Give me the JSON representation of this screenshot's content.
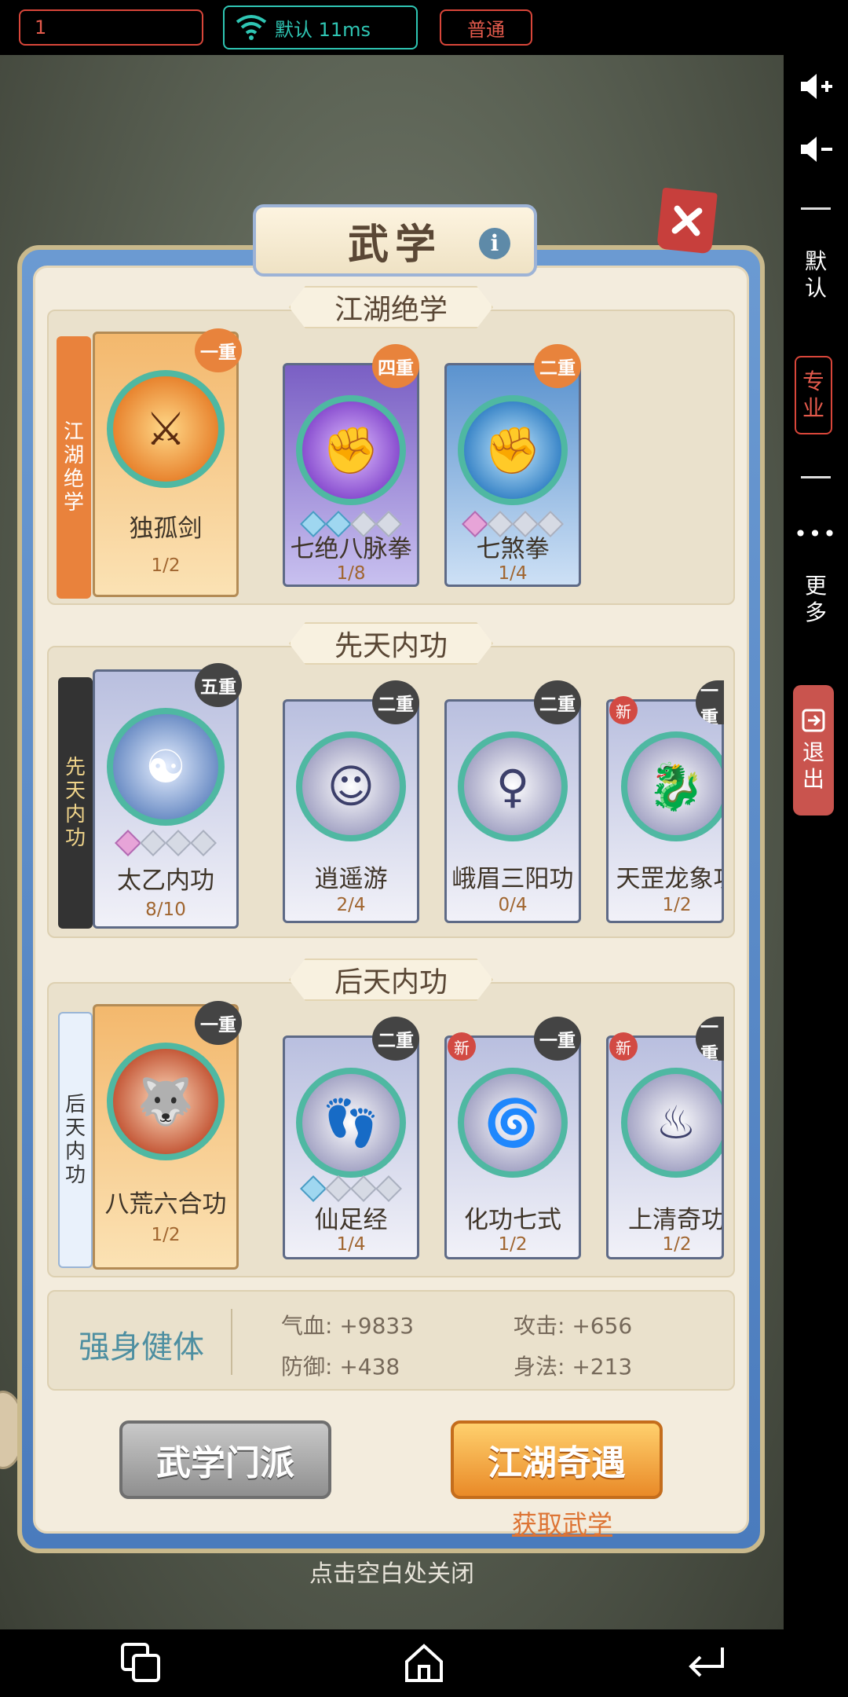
{
  "top_bar": {
    "field_value": "1",
    "network_label": "默认 11ms",
    "mode_label": "普通"
  },
  "right_bar": {
    "default_label": "默认",
    "pro_label": "专业",
    "more_label": "更多",
    "exit_label": "退出"
  },
  "dialog": {
    "title": "武学",
    "info_icon": "i",
    "sections": [
      {
        "title": "江湖绝学",
        "scroll_label": "江湖绝学",
        "cards": [
          {
            "name": "独孤剑",
            "count": "1/2",
            "tier": "一重",
            "style": "gold",
            "icon": "sword"
          },
          {
            "name": "七绝八脉拳",
            "count": "1/8",
            "tier": "四重",
            "style": "purple",
            "icon": "fist"
          },
          {
            "name": "七煞拳",
            "count": "1/4",
            "tier": "二重",
            "style": "blue",
            "icon": "fist"
          }
        ]
      },
      {
        "title": "先天内功",
        "scroll_label": "先天内功",
        "cards": [
          {
            "name": "太乙内功",
            "count": "8/10",
            "tier": "五重",
            "style": "silver",
            "icon": "yin-yang"
          },
          {
            "name": "逍遥游",
            "count": "2/4",
            "tier": "二重",
            "style": "silver",
            "icon": "monk"
          },
          {
            "name": "峨眉三阳功",
            "count": "0/4",
            "tier": "二重",
            "style": "silver",
            "icon": "lady"
          },
          {
            "name": "天罡龙象功",
            "count": "1/2",
            "tier": "一重",
            "new": "新",
            "style": "silver",
            "icon": "dragon"
          }
        ]
      },
      {
        "title": "后天内功",
        "scroll_label": "后天内功",
        "cards": [
          {
            "name": "八荒六合功",
            "count": "1/2",
            "tier": "一重",
            "style": "gold",
            "icon": "wolf"
          },
          {
            "name": "仙足经",
            "count": "1/4",
            "tier": "二重",
            "style": "silver",
            "icon": "foot"
          },
          {
            "name": "化功七式",
            "count": "1/2",
            "tier": "一重",
            "new": "新",
            "style": "silver",
            "icon": "swirl"
          },
          {
            "name": "上清奇功",
            "count": "1/2",
            "tier": "一重",
            "new": "新",
            "style": "silver",
            "icon": "bowl"
          }
        ]
      }
    ],
    "stats": {
      "title": "强身健体",
      "hp": "气血: +9833",
      "attack": "攻击: +656",
      "defense": "防御: +438",
      "agility": "身法: +213"
    },
    "school_button": "武学门派",
    "adventure_button": "江湖奇遇",
    "get_link": "获取武学"
  },
  "close_hint": "点击空白处关闭",
  "colors": {
    "accent_red": "#d9463a",
    "accent_teal": "#2fc6b4",
    "dialog_blue": "#4a7bbd",
    "panel_cream": "#f3ecdd"
  }
}
